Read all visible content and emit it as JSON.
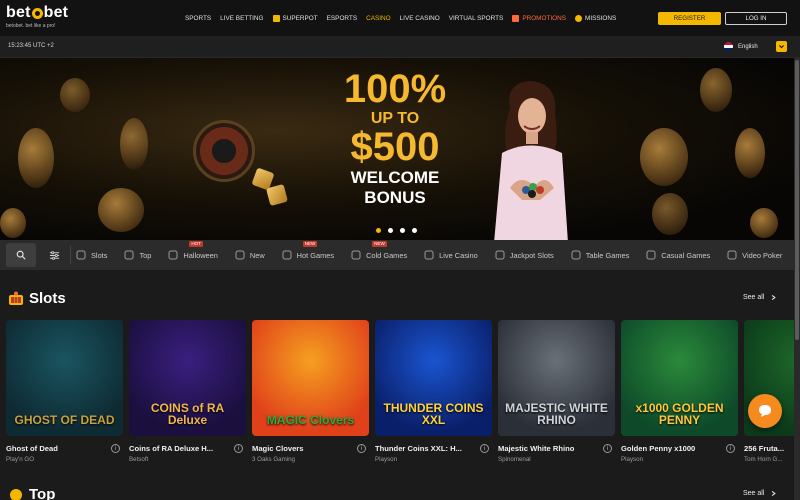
{
  "header": {
    "logo": {
      "brand": "betobet",
      "tagline": "betobet. bet like a pro!"
    },
    "nav": [
      {
        "label": "SPORTS",
        "icon": "",
        "variant": "normal"
      },
      {
        "label": "LIVE BETTING",
        "icon": "",
        "variant": "normal"
      },
      {
        "label": "SUPERPOT",
        "icon": "trophy-icon",
        "variant": "normal"
      },
      {
        "label": "ESPORTS",
        "icon": "",
        "variant": "normal"
      },
      {
        "label": "CASINO",
        "icon": "",
        "variant": "active"
      },
      {
        "label": "LIVE CASINO",
        "icon": "",
        "variant": "normal"
      },
      {
        "label": "VIRTUAL SPORTS",
        "icon": "",
        "variant": "normal"
      },
      {
        "label": "PROMOTIONS",
        "icon": "fire-icon",
        "variant": "promo"
      },
      {
        "label": "MISSIONS",
        "icon": "coin-icon",
        "variant": "normal"
      }
    ],
    "register_label": "REGISTER",
    "login_label": "LOG IN"
  },
  "subbar": {
    "clock": "15:23:45 UTC +2",
    "language": "English"
  },
  "banner": {
    "line1": "100%",
    "line2": "UP TO",
    "line3": "$500",
    "line4": "WELCOME",
    "line5": "BONUS",
    "slides": 4,
    "active_slide": 0
  },
  "categories": [
    {
      "label": "Slots",
      "icon": "slot-icon",
      "badge": ""
    },
    {
      "label": "Top",
      "icon": "crown-icon",
      "badge": ""
    },
    {
      "label": "Halloween",
      "icon": "pumpkin-icon",
      "badge": "HOT"
    },
    {
      "label": "New",
      "icon": "star-icon",
      "badge": ""
    },
    {
      "label": "Hot Games",
      "icon": "flame-icon",
      "badge": "NEW"
    },
    {
      "label": "Cold Games",
      "icon": "snowflake-icon",
      "badge": "NEW"
    },
    {
      "label": "Live Casino",
      "icon": "chip-icon",
      "badge": ""
    },
    {
      "label": "Jackpot Slots",
      "icon": "jackpot-icon",
      "badge": ""
    },
    {
      "label": "Table Games",
      "icon": "cards-icon",
      "badge": ""
    },
    {
      "label": "Casual Games",
      "icon": "gamepad-icon",
      "badge": ""
    },
    {
      "label": "Video Poker",
      "icon": "poker-icon",
      "badge": ""
    }
  ],
  "section": {
    "title": "Slots",
    "see_all": "See all"
  },
  "section2": {
    "title": "Top",
    "see_all": "See all"
  },
  "games": [
    {
      "name": "Ghost of Dead",
      "provider": "Play'n GO",
      "art": "GHOST OF DEAD",
      "colors": [
        "#0e2a33",
        "#1a5560",
        "#c8a040"
      ]
    },
    {
      "name": "Coins of RA Deluxe H...",
      "provider": "Betsoft",
      "art": "COINS of RA Deluxe",
      "colors": [
        "#1a0f3d",
        "#3a1f80",
        "#f0b84a"
      ]
    },
    {
      "name": "Magic Clovers",
      "provider": "3 Oaks Gaming",
      "art": "MAGIC Clovers",
      "colors": [
        "#e0401a",
        "#f5a020",
        "#2fa840"
      ]
    },
    {
      "name": "Thunder Coins XXL: H...",
      "provider": "Playson",
      "art": "THUNDER COINS XXL",
      "colors": [
        "#0a1f6a",
        "#1a55d0",
        "#ffd23a"
      ]
    },
    {
      "name": "Majestic White Rhino",
      "provider": "Spinomenal",
      "art": "MAJESTIC WHITE RHINO",
      "colors": [
        "#2a2f38",
        "#6a7078",
        "#d0d3d8"
      ]
    },
    {
      "name": "Golden Penny x1000",
      "provider": "Playson",
      "art": "x1000 GOLDEN PENNY",
      "colors": [
        "#0e4a2a",
        "#2a8a3a",
        "#ffc83a"
      ]
    },
    {
      "name": "256 Fruta...",
      "provider": "Tom Horn G...",
      "art": "",
      "colors": [
        "#0c3a1a",
        "#1e6a2a",
        "#e8c040"
      ]
    }
  ]
}
